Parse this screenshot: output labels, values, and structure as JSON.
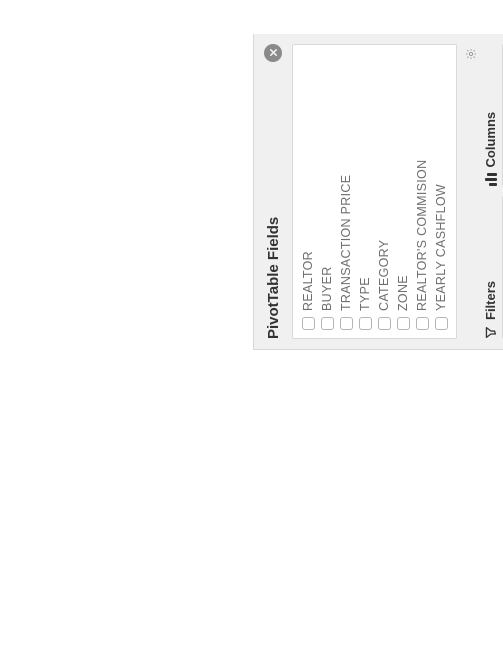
{
  "panel": {
    "title": "PivotTable Fields",
    "fields": [
      {
        "label": "REALTOR"
      },
      {
        "label": "BUYER"
      },
      {
        "label": "TRANSACTION PRICE"
      },
      {
        "label": "TYPE"
      },
      {
        "label": "CATEGORY"
      },
      {
        "label": "ZONE"
      },
      {
        "label": "REALTOR'S COMMISION"
      },
      {
        "label": "YEARLY CASHFLOW"
      }
    ],
    "areas": {
      "filters": {
        "label": "Filters"
      },
      "columns": {
        "label": "Columns"
      }
    }
  }
}
